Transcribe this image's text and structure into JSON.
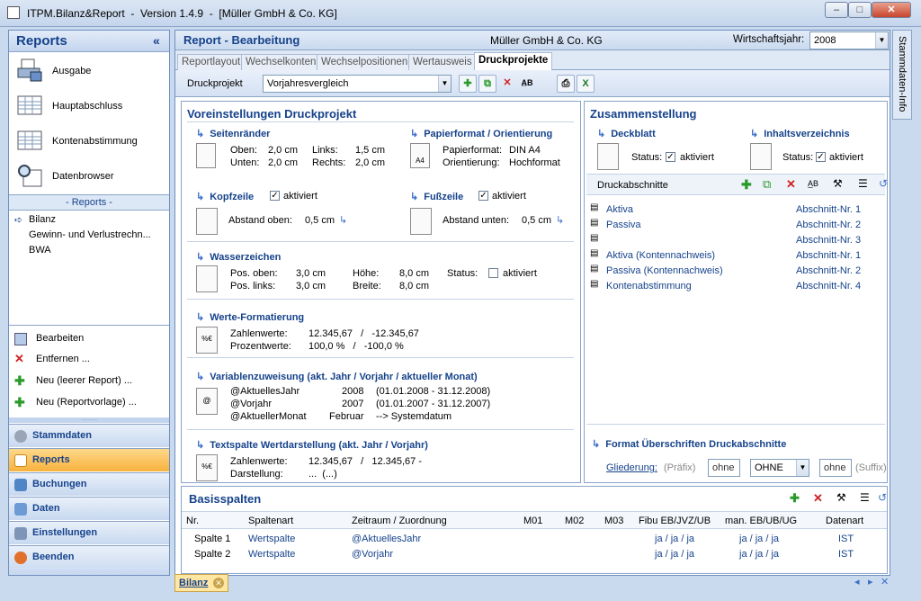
{
  "window": {
    "title": "ITPM.Bilanz&Report  -  Version 1.4.9  -  [Müller GmbH & Co. KG]"
  },
  "sidebar": {
    "title": "Reports",
    "collapse": "«",
    "items": [
      {
        "label": "Ausgabe"
      },
      {
        "label": "Hauptabschluss"
      },
      {
        "label": "Kontenabstimmung"
      },
      {
        "label": "Datenbrowser"
      }
    ],
    "reports_header": "- Reports -",
    "reports": [
      {
        "label": "Bilanz"
      },
      {
        "label": "Gewinn- und Verlustrechn..."
      },
      {
        "label": "BWA"
      }
    ],
    "actions": [
      {
        "label": "Bearbeiten"
      },
      {
        "label": "Entfernen ..."
      },
      {
        "label": "Neu   (leerer Report) ..."
      },
      {
        "label": "Neu   (Reportvorlage) ..."
      }
    ],
    "nav": [
      {
        "label": "Stammdaten"
      },
      {
        "label": "Reports"
      },
      {
        "label": "Buchungen"
      },
      {
        "label": "Daten"
      },
      {
        "label": "Einstellungen"
      },
      {
        "label": "Beenden"
      }
    ]
  },
  "header": {
    "title": "Report - Bearbeitung",
    "company": "Müller GmbH & Co. KG",
    "wj_label": "Wirtschaftsjahr:",
    "wj_value": "2008"
  },
  "tabs": [
    {
      "label": "Reportlayout"
    },
    {
      "label": "Wechselkonten"
    },
    {
      "label": "Wechselpositionen"
    },
    {
      "label": "Wertausweis"
    },
    {
      "label": "Druckprojekte"
    }
  ],
  "toolbar": {
    "label": "Druckprojekt",
    "value": "Vorjahresvergleich"
  },
  "voreinst": {
    "title": "Voreinstellungen Druckprojekt",
    "seitenraender": {
      "title": "Seitenränder",
      "oben_l": "Oben:",
      "oben": "2,0 cm",
      "unten_l": "Unten:",
      "unten": "2,0 cm",
      "links_l": "Links:",
      "links": "1,5 cm",
      "rechts_l": "Rechts:",
      "rechts": "2,0 cm"
    },
    "papier": {
      "title": "Papierformat / Orientierung",
      "pf_l": "Papierformat:",
      "pf": "DIN A4",
      "or_l": "Orientierung:",
      "or": "Hochformat",
      "a4": "A4"
    },
    "kopfzeile": {
      "title": "Kopfzeile",
      "chk": "aktiviert",
      "abst_l": "Abstand oben:",
      "abst": "0,5 cm"
    },
    "fusszeile": {
      "title": "Fußzeile",
      "chk": "aktiviert",
      "abst_l": "Abstand unten:",
      "abst": "0,5 cm"
    },
    "wasser": {
      "title": "Wasserzeichen",
      "po_l": "Pos. oben:",
      "po": "3,0 cm",
      "pl_l": "Pos. links:",
      "pl": "3,0 cm",
      "h_l": "Höhe:",
      "h": "8,0 cm",
      "b_l": "Breite:",
      "b": "8,0 cm",
      "st_l": "Status:",
      "st": "aktiviert"
    },
    "werte": {
      "title": "Werte-Formatierung",
      "z_l": "Zahlenwerte:",
      "z": "12.345,67   /   -12.345,67",
      "p_l": "Prozentwerte:",
      "p": "100,0 %   /   -100,0 %"
    },
    "variablen": {
      "title": "Variablenzuweisung  (akt. Jahr / Vorjahr / aktueller Monat)",
      "rows": [
        {
          "n": "@AktuellesJahr",
          "v": "2008",
          "d": "(01.01.2008 - 31.12.2008)"
        },
        {
          "n": "@Vorjahr",
          "v": "2007",
          "d": "(01.01.2007 - 31.12.2007)"
        },
        {
          "n": "@AktuellerMonat",
          "v": "Februar",
          "d": "--> Systemdatum"
        }
      ]
    },
    "textspalte": {
      "title": "Textspalte Wertdarstellung  (akt. Jahr / Vorjahr)",
      "z_l": "Zahlenwerte:",
      "z": "12.345,67   /   12.345,67 -",
      "d_l": "Darstellung:",
      "d": "...  (...)"
    }
  },
  "zusammen": {
    "title": "Zusammenstellung",
    "deckblatt": {
      "title": "Deckblatt",
      "st_l": "Status:",
      "chk": "aktiviert"
    },
    "inhalt": {
      "title": "Inhaltsverzeichnis",
      "st_l": "Status:",
      "chk": "aktiviert"
    },
    "druck_l": "Druckabschnitte",
    "abschnitte": [
      {
        "n": "Aktiva",
        "a": "Abschnitt-Nr. 1"
      },
      {
        "n": "Passiva",
        "a": "Abschnitt-Nr. 2"
      },
      {
        "n": "",
        "a": "Abschnitt-Nr. 3"
      },
      {
        "n": "Aktiva (Kontennachweis)",
        "a": "Abschnitt-Nr. 1"
      },
      {
        "n": "Passiva (Kontennachweis)",
        "a": "Abschnitt-Nr. 2"
      },
      {
        "n": "Kontenabstimmung",
        "a": "Abschnitt-Nr. 4"
      }
    ],
    "format": {
      "title": "Format Überschriften Druckabschnitte",
      "gl": "Gliederung:",
      "praefix": "(Präfix)",
      "ohne1": "ohne",
      "ohne2": "OHNE",
      "ohne3": "ohne",
      "suffix": "(Suffix)"
    }
  },
  "basis": {
    "title": "Basisspalten",
    "cols": [
      "Nr.",
      "Spaltenart",
      "Zeitraum / Zuordnung",
      "M01",
      "M02",
      "M03",
      "Fibu EB/JVZ/UB",
      "man. EB/UB/UG",
      "Datenart"
    ],
    "rows": [
      {
        "nr": "Spalte 1",
        "art": "Wertspalte",
        "zeit": "@AktuellesJahr",
        "fibu": "ja / ja / ja",
        "man": "ja / ja / ja",
        "dat": "IST"
      },
      {
        "nr": "Spalte 2",
        "art": "Wertspalte",
        "zeit": "@Vorjahr",
        "fibu": "ja / ja / ja",
        "man": "ja / ja / ja",
        "dat": "IST"
      }
    ]
  },
  "rightstrip": {
    "label": "Stammdaten-Info"
  },
  "bottom": {
    "tab": "Bilanz"
  }
}
